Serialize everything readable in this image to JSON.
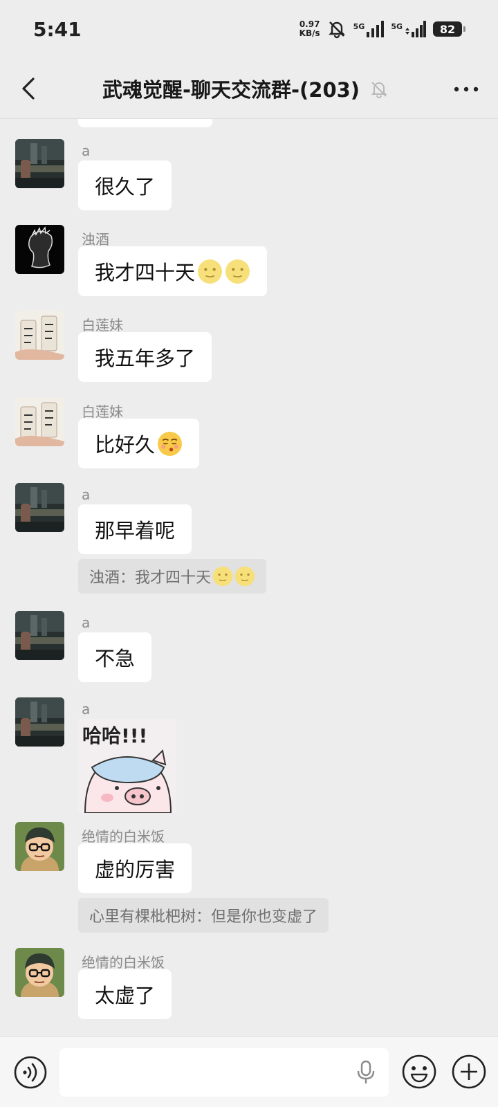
{
  "status_bar": {
    "time": "5:41",
    "net_speed_value": "0.97",
    "net_speed_unit": "KB/s",
    "signal1_label": "5G",
    "signal2_label": "5G",
    "battery": "82"
  },
  "header": {
    "title": "武魂觉醒-聊天交流群-(203)"
  },
  "messages": [
    {
      "sender": "a",
      "text": "很久了"
    },
    {
      "sender": "浊酒",
      "text": "我才四十天"
    },
    {
      "sender": "白莲妹",
      "text": "我五年多了"
    },
    {
      "sender": "白莲妹",
      "text": "比好久"
    },
    {
      "sender": "a",
      "text": "那早着呢",
      "quote": "浊酒：我才四十天"
    },
    {
      "sender": "a",
      "text": "不急"
    },
    {
      "sender": "a",
      "sticker_text": "哈哈!!!"
    },
    {
      "sender": "绝情的白米饭",
      "text": "虚的厉害",
      "quote": "心里有棵枇杷树：但是你也变虚了"
    },
    {
      "sender": "绝情的白米饭",
      "text": "太虚了"
    }
  ],
  "input_bar": {
    "placeholder": ""
  },
  "icons": {
    "back": "chevron-left-icon",
    "mute": "bell-off-icon",
    "more": "more-dots-icon",
    "voice": "voice-icon",
    "mic": "mic-icon",
    "emoji": "smile-icon",
    "plus": "plus-circle-icon"
  },
  "colors": {
    "background": "#ededed",
    "bubble": "#ffffff",
    "quote_bg": "#e1e1e1",
    "sender_text": "#8a8a8a"
  }
}
